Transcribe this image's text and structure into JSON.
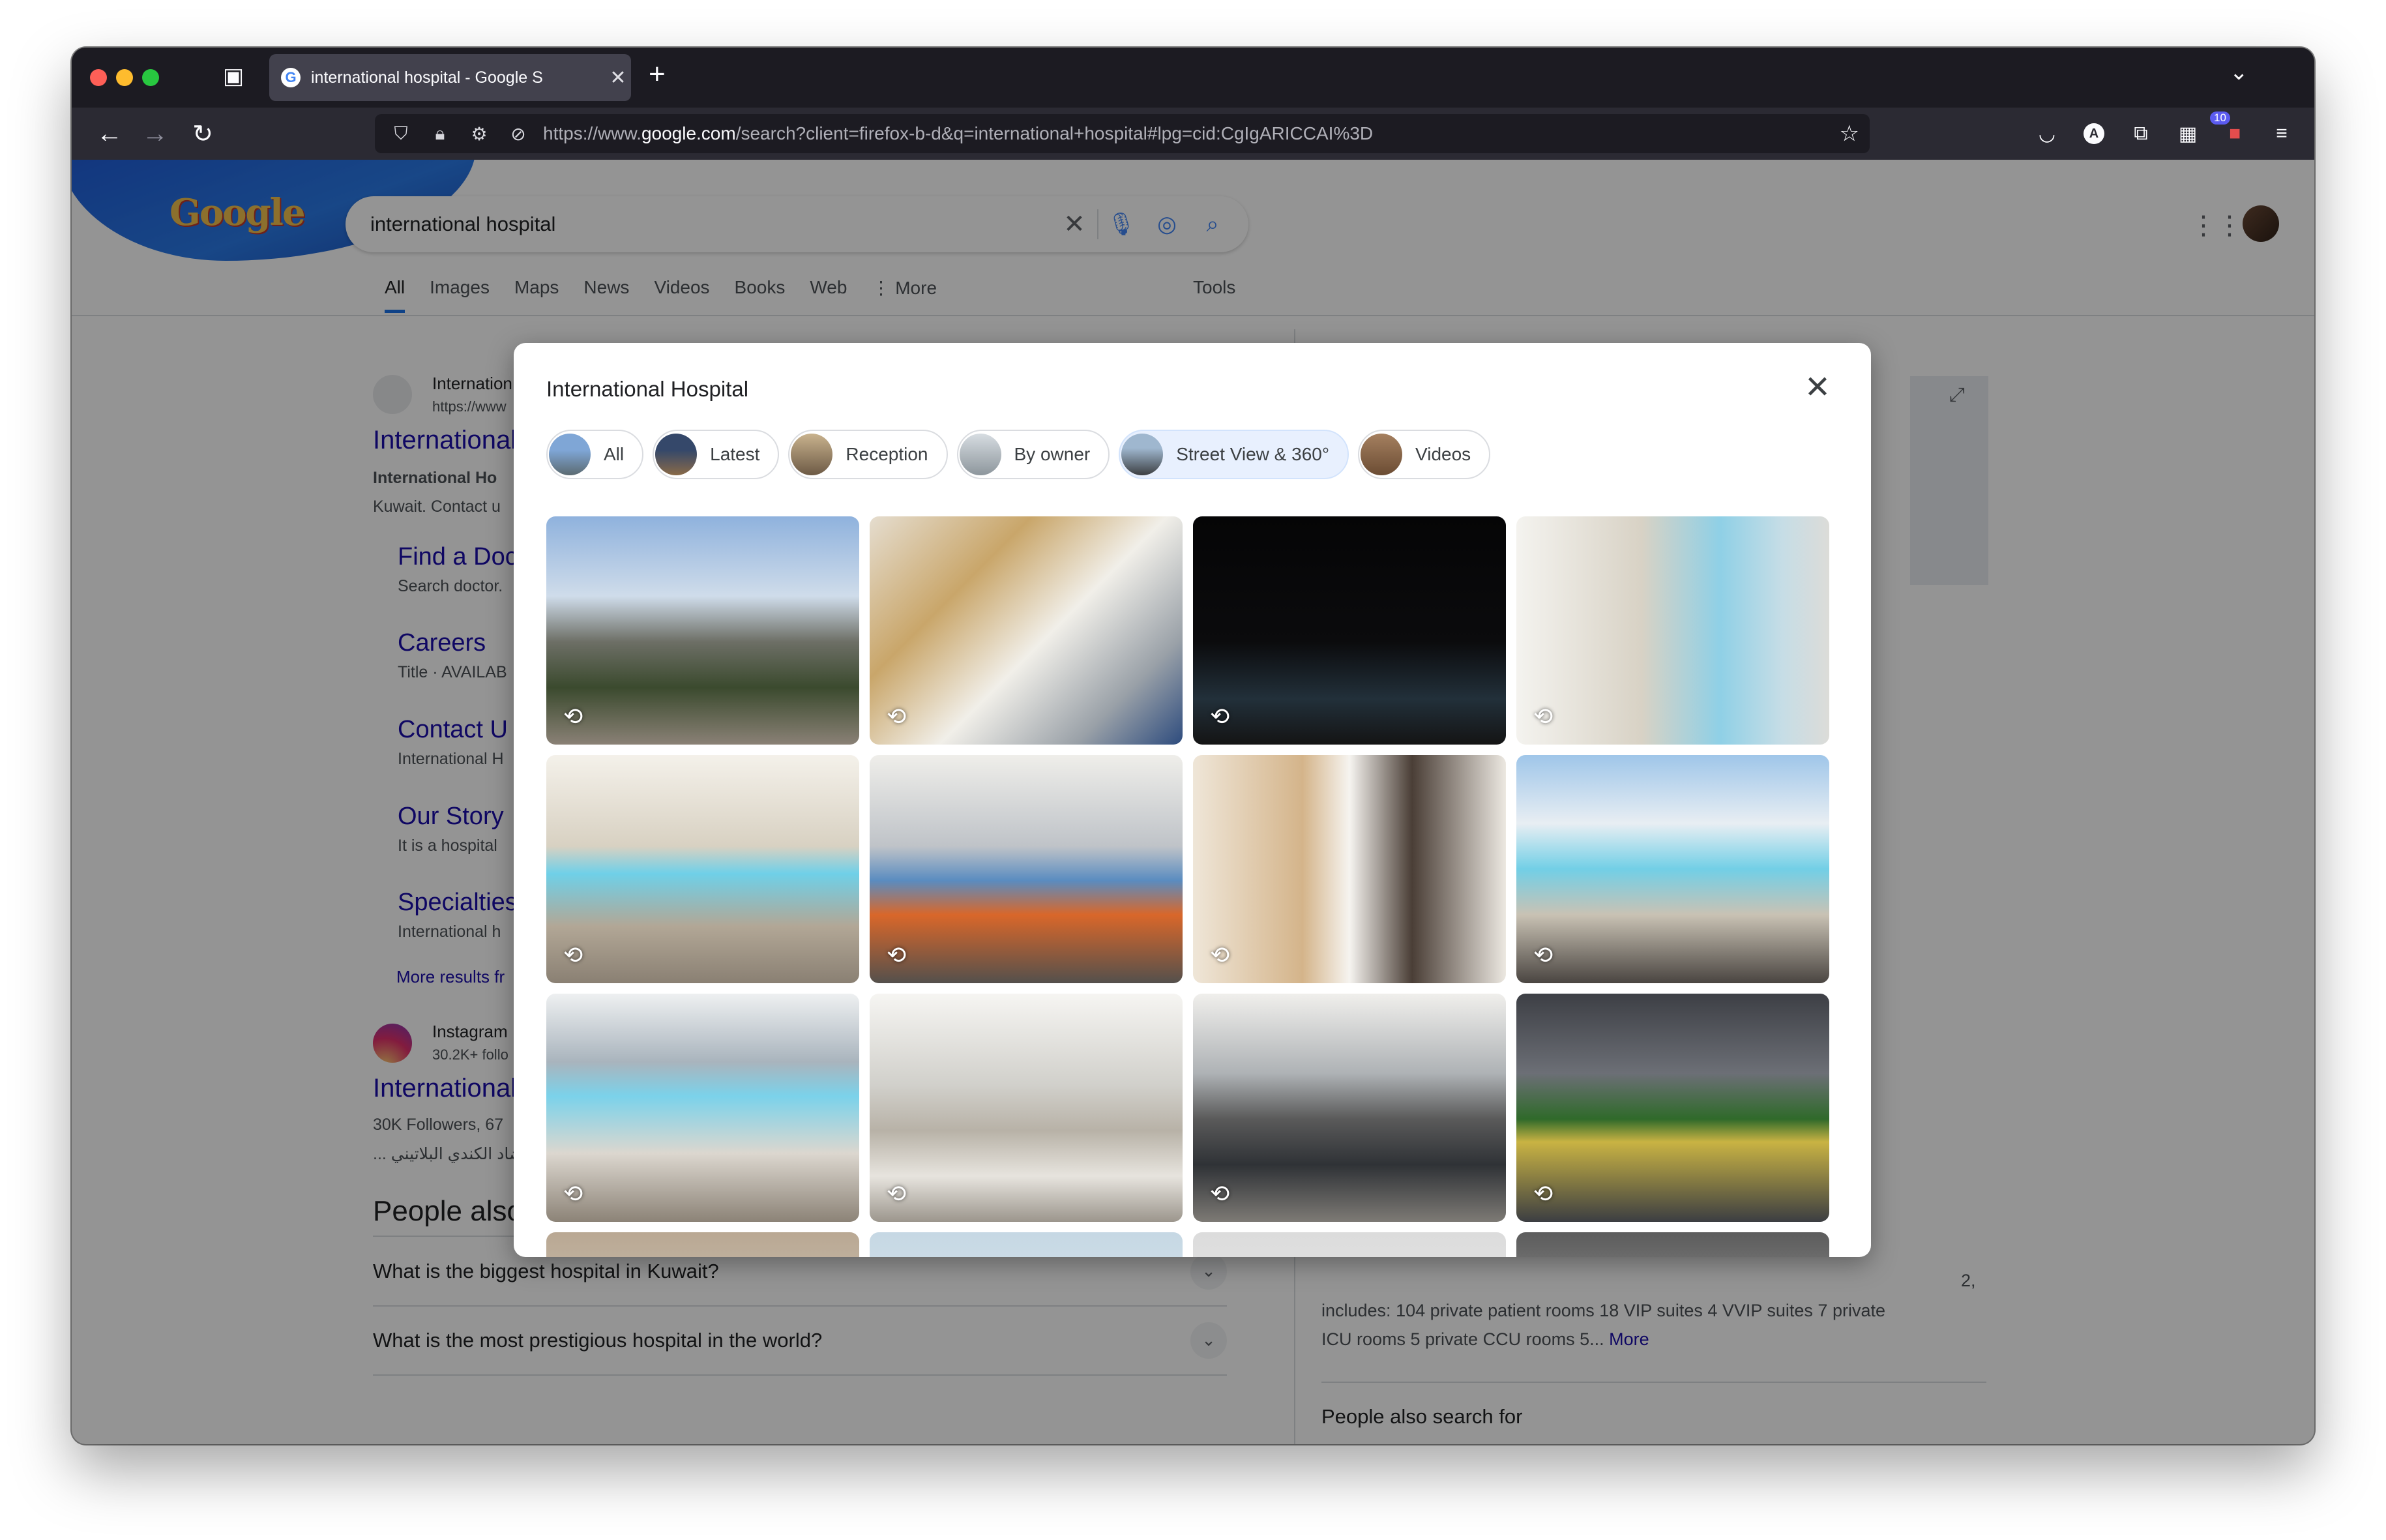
{
  "browser": {
    "tab_title": "international hospital - Google S",
    "url_prefix": "https://www.",
    "url_domain": "google.com",
    "url_rest": "/search?client=firefox-b-d&q=international+hospital#lpg=cid:CgIgARICCAI%3D",
    "notification_count": "10",
    "account_initial": "A"
  },
  "google": {
    "search_query": "international hospital",
    "tabs": [
      "All",
      "Images",
      "Maps",
      "News",
      "Videos",
      "Books",
      "Web"
    ],
    "more_label": "More",
    "tools_label": "Tools"
  },
  "results": {
    "r1_site": "Internation",
    "r1_url": "https://www",
    "r1_title": "International",
    "r1_snippet_bold": "International Ho",
    "r1_snippet2": "Kuwait. Contact u",
    "sitelinks": [
      {
        "title": "Find a Doc",
        "desc": "Search doctor."
      },
      {
        "title": "Careers",
        "desc": "Title · AVAILAB"
      },
      {
        "title": "Contact U",
        "desc": "International H"
      },
      {
        "title": "Our Story",
        "desc": "It is a hospital"
      },
      {
        "title": "Specialties",
        "desc": "International h"
      }
    ],
    "more_results": "More results fr",
    "r2_site": "Instagram",
    "r2_meta": "30.2K+ follo",
    "r2_title": "International",
    "r2_snippet": "30K Followers, 67",
    "r2_snippet_ar": "... عضاد الكندي البلاتيني"
  },
  "paa": {
    "heading": "People also ask",
    "questions": [
      "What is the biggest hospital in Kuwait?",
      "What is the most prestigious hospital in the world?"
    ]
  },
  "right_panel": {
    "desc_line0": "2,",
    "desc_line1": "includes: 104 private patient rooms 18 VIP suites 4 VVIP suites 7 private",
    "desc_line2": "ICU rooms 5 private CCU rooms 5...",
    "more_link": "More",
    "people_also_search": "People also search for"
  },
  "modal": {
    "title": "International Hospital",
    "chips": [
      "All",
      "Latest",
      "Reception",
      "By owner",
      "Street View & 360°",
      "Videos"
    ],
    "selected_chip": "Street View & 360°",
    "photo_count_rows": 3
  },
  "colors": {
    "accent": "#1a73e8",
    "link": "#1a0dab",
    "browser_chrome": "#2b2a33",
    "chip_selected_bg": "#e8f0fe"
  }
}
